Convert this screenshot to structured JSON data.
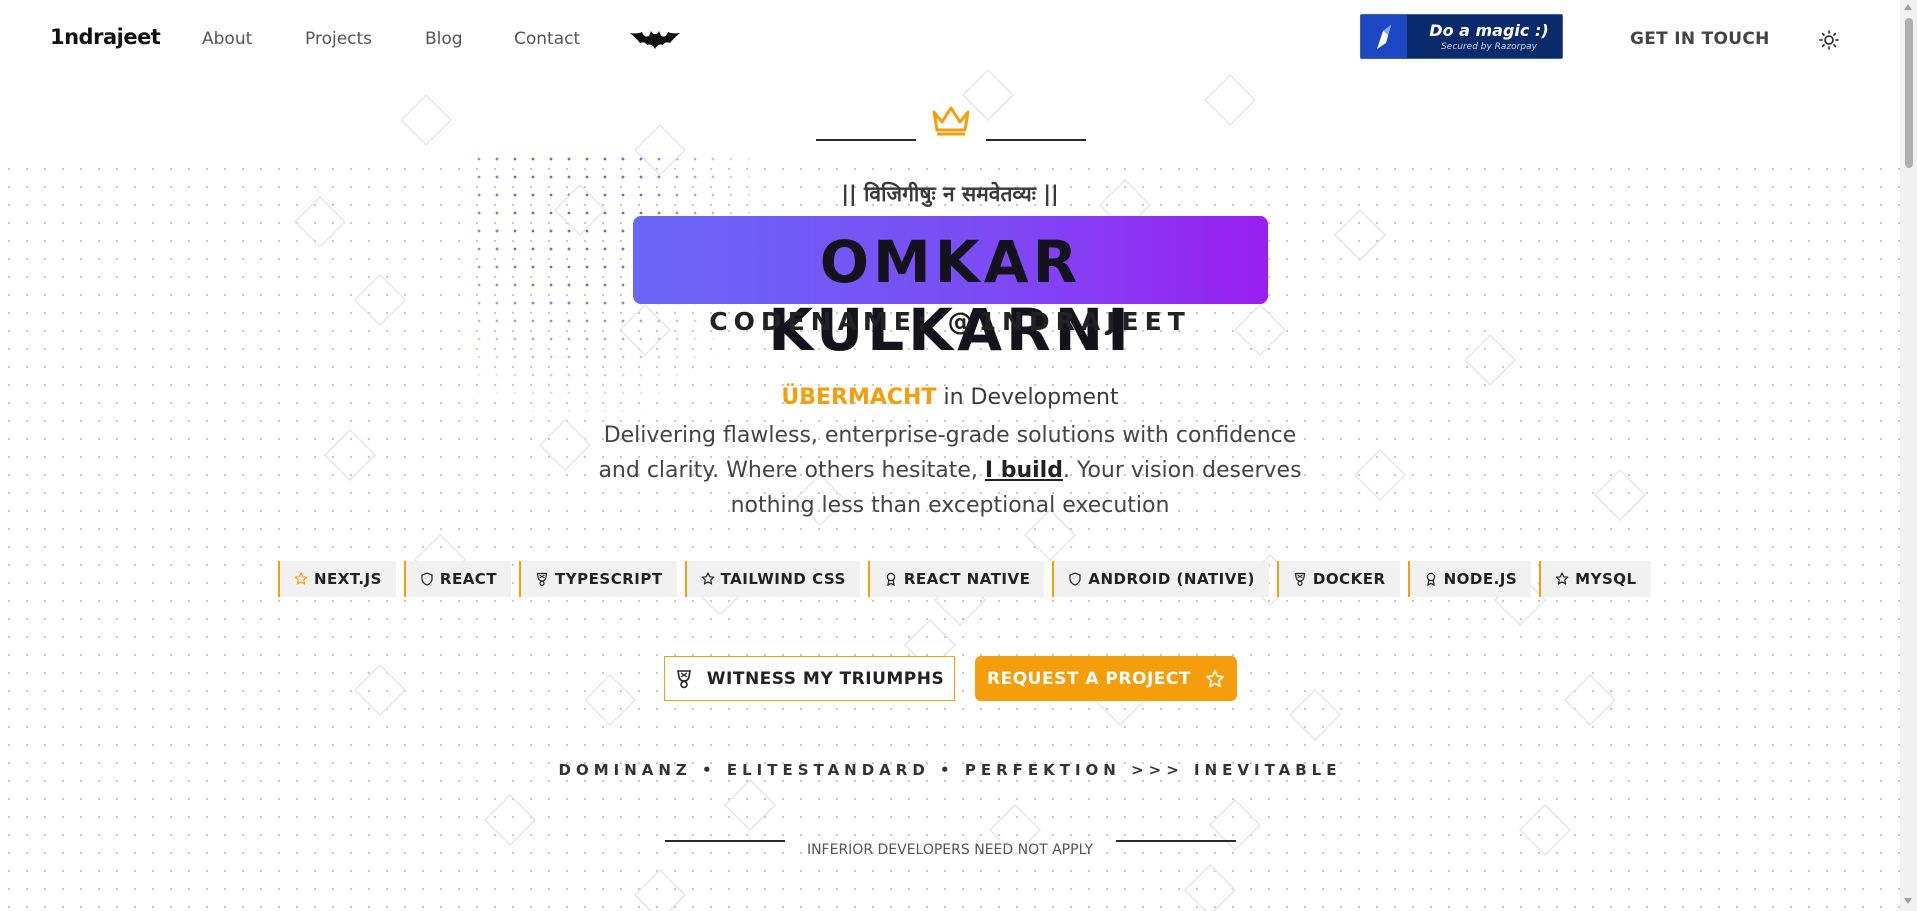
{
  "nav": {
    "logo": "1ndrajeet",
    "links": [
      "About",
      "Projects",
      "Blog",
      "Contact"
    ],
    "bat_icon": "bat-icon",
    "razorpay": {
      "title": "Do a magic :)",
      "subtitle": "Secured by Razorpay",
      "brand_color": "#0a2a6b"
    },
    "cta": "GET IN TOUCH",
    "theme_icon": "sun-icon"
  },
  "hero": {
    "crown_icon": "crown-icon",
    "sanskrit": "|| विजिगीषुः न समवेतव्यः ||",
    "name": "OMKAR KULKARNI",
    "codename": "CODENAME: @1NDRAJEET",
    "tagline_highlight": "ÜBERMACHT",
    "tagline_rest": " in Development",
    "desc_part1": "Delivering flawless, enterprise-grade solutions with confidence and clarity. Where others hesitate, ",
    "desc_strong": "I build",
    "desc_part2": ". Your vision deserves nothing less than exceptional execution",
    "tech": [
      {
        "label": "NEXT.JS",
        "icon": "star-icon"
      },
      {
        "label": "REACT",
        "icon": "shield-icon"
      },
      {
        "label": "TYPESCRIPT",
        "icon": "trophy-icon"
      },
      {
        "label": "TAILWIND CSS",
        "icon": "star-icon"
      },
      {
        "label": "REACT NATIVE",
        "icon": "award-icon"
      },
      {
        "label": "ANDROID (NATIVE)",
        "icon": "shield-icon"
      },
      {
        "label": "DOCKER",
        "icon": "trophy-icon"
      },
      {
        "label": "NODE.JS",
        "icon": "award-icon"
      },
      {
        "label": "MYSQL",
        "icon": "star-icon"
      }
    ],
    "btn_witness": "WITNESS MY TRIUMPHS",
    "btn_request": "REQUEST A PROJECT",
    "motto": "DOMINANZ • ELITESTANDARD • PERFEKTION >>> INEVITABLE",
    "disclaimer": "INFERIOR DEVELOPERS NEED NOT APPLY"
  },
  "colors": {
    "accent": "#f59e0b",
    "gradient_start": "#6a66f5",
    "gradient_end": "#9a1ff0"
  }
}
